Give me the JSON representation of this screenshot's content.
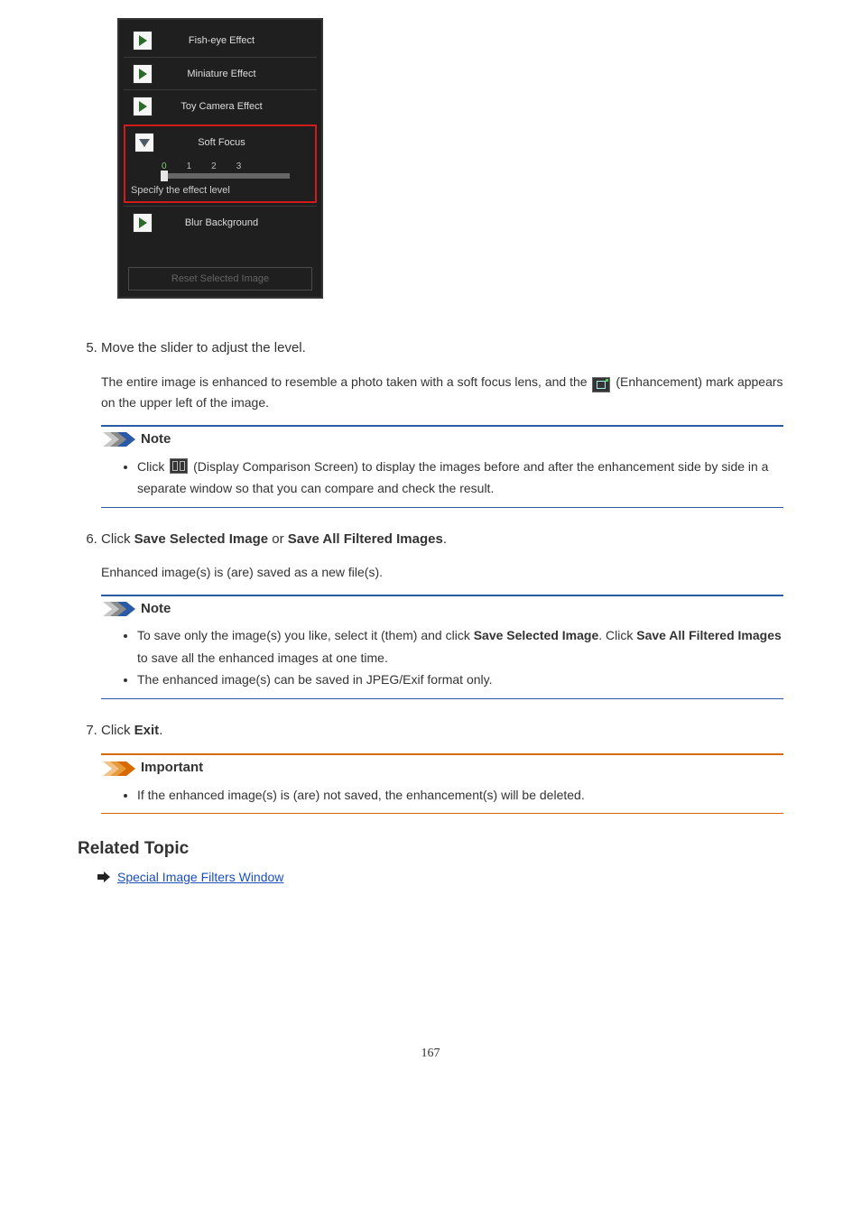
{
  "panel": {
    "effects": {
      "fisheye": "Fish-eye Effect",
      "miniature": "Miniature Effect",
      "toy": "Toy Camera Effect",
      "soft": "Soft Focus",
      "blur": "Blur Background"
    },
    "slider": {
      "ticks": [
        "0",
        "1",
        "2",
        "3"
      ],
      "caption": "Specify the effect level"
    },
    "reset_label": "Reset Selected Image"
  },
  "steps": {
    "s5": {
      "title": "Move the slider to adjust the level.",
      "body_a": "The entire image is enhanced to resemble a photo taken with a soft focus lens, and the ",
      "body_b": " (Enhancement) mark appears on the upper left of the image.",
      "note_a": "Click ",
      "note_b": " (Display Comparison Screen) to display the images before and after the enhancement side by side in a separate window so that you can compare and check the result."
    },
    "s6": {
      "title_a": "Click ",
      "title_b": "Save Selected Image",
      "title_c": " or ",
      "title_d": "Save All Filtered Images",
      "title_e": ".",
      "body": "Enhanced image(s) is (are) saved as a new file(s).",
      "note1_a": "To save only the image(s) you like, select it (them) and click ",
      "note1_b": "Save Selected Image",
      "note1_c": ". Click ",
      "note1_d": "Save All Filtered Images",
      "note1_e": " to save all the enhanced images at one time.",
      "note2": "The enhanced image(s) can be saved in JPEG/Exif format only."
    },
    "s7": {
      "title_a": "Click ",
      "title_b": "Exit",
      "title_c": ".",
      "imp": "If the enhanced image(s) is (are) not saved, the enhancement(s) will be deleted."
    }
  },
  "labels": {
    "note": "Note",
    "important": "Important",
    "related": "Related Topic",
    "link": "Special Image Filters Window"
  },
  "page_number": "167"
}
